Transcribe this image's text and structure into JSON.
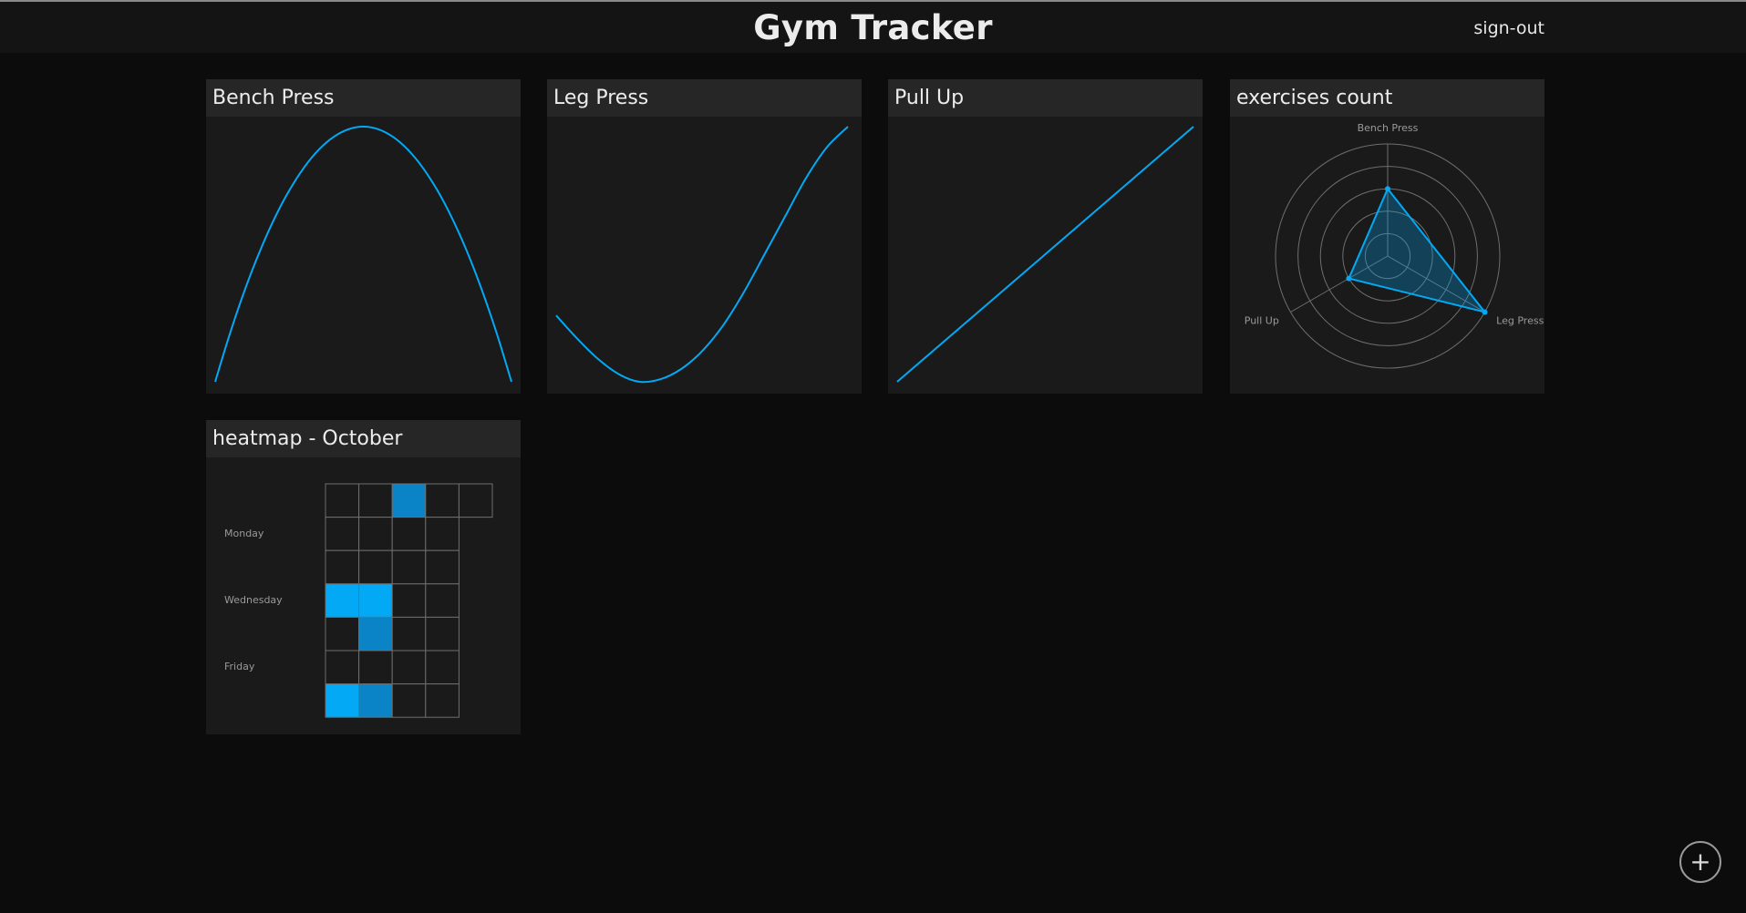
{
  "header": {
    "title": "Gym Tracker",
    "signout_label": "sign-out"
  },
  "add_button": {
    "icon": "plus-icon",
    "label": "+"
  },
  "colors": {
    "accent": "#03a9f4",
    "background": "#0c0c0c",
    "card": "#1a1a1b",
    "card_header": "#262626"
  },
  "cards": [
    {
      "title": "Bench Press",
      "chart_data": {
        "type": "line",
        "x": [
          0,
          1,
          2,
          3,
          4,
          5,
          6,
          7,
          8,
          9,
          10,
          11,
          12,
          13,
          14,
          15,
          16,
          17,
          18,
          19,
          20
        ],
        "values": [
          0,
          19,
          36,
          51,
          64,
          75,
          84,
          91,
          96,
          99,
          100,
          99,
          96,
          91,
          84,
          75,
          64,
          51,
          36,
          19,
          0
        ],
        "title": "",
        "xlabel": "",
        "ylabel": "",
        "grid": false,
        "legend": "none"
      }
    },
    {
      "title": "Leg Press",
      "chart_data": {
        "type": "line",
        "x": [
          0,
          1,
          2,
          3,
          4,
          5,
          6,
          7,
          8,
          9,
          10,
          11,
          12,
          13,
          14
        ],
        "values": [
          26,
          17,
          9,
          3,
          0,
          1,
          5,
          12,
          22,
          35,
          50,
          65,
          80,
          92,
          100
        ],
        "title": "",
        "xlabel": "",
        "ylabel": "",
        "grid": false,
        "legend": "none"
      }
    },
    {
      "title": "Pull Up",
      "chart_data": {
        "type": "line",
        "x": [
          0,
          1
        ],
        "values": [
          0,
          100
        ],
        "title": "",
        "xlabel": "",
        "ylabel": "",
        "grid": false,
        "legend": "none"
      }
    },
    {
      "title": "exercises count",
      "chart_data": {
        "type": "radar",
        "categories": [
          "Bench Press",
          "Leg Press",
          "Pull Up"
        ],
        "values": [
          3,
          5,
          2
        ],
        "max": 5,
        "rings": 5
      }
    },
    {
      "title": "heatmap - October",
      "chart_data": {
        "type": "heatmap",
        "row_labels": [
          "",
          "Monday",
          "",
          "Wednesday",
          "",
          "Friday",
          ""
        ],
        "weeks": [
          [
            0,
            0,
            0,
            2,
            0,
            0,
            2
          ],
          [
            0,
            0,
            0,
            2,
            1,
            0,
            1
          ],
          [
            1,
            0,
            0,
            0,
            0,
            0,
            0
          ],
          [
            0,
            0,
            0,
            0,
            0,
            0,
            0
          ],
          [
            0,
            null,
            null,
            null,
            null,
            null,
            null
          ]
        ],
        "levels": [
          "#1a1a1b",
          "#0a84c6",
          "#03a9f4"
        ]
      }
    }
  ]
}
